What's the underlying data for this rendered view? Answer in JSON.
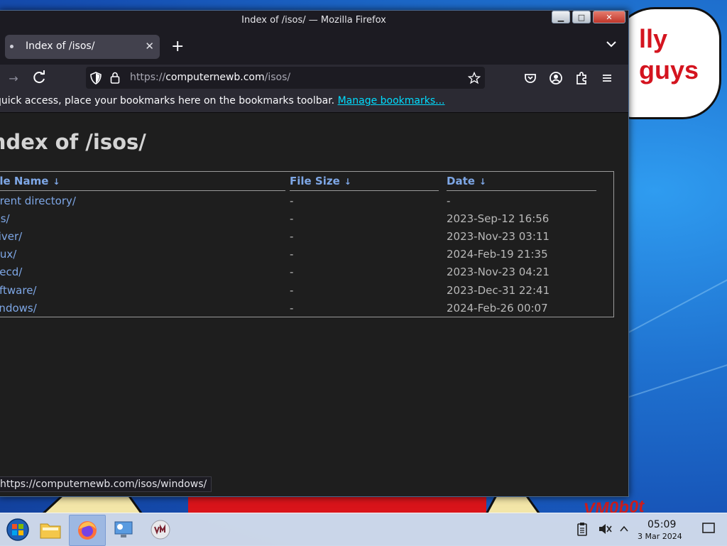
{
  "window": {
    "title": "Index of /isos/ — Mozilla Firefox"
  },
  "tabs": [
    {
      "label": "Index of /isos/"
    }
  ],
  "urlbar": {
    "scheme": "https://",
    "host": "computernewb.com",
    "path": "/isos/"
  },
  "bookmarks_toolbar": {
    "message": "quick access, place your bookmarks here on the bookmarks toolbar.",
    "link_label": "Manage bookmarks..."
  },
  "page": {
    "title": "Index of /isos/",
    "columns": [
      "File Name",
      "File Size",
      "Date"
    ],
    "sort_arrow": "↓",
    "rows": [
      {
        "name": "Parent directory/",
        "size": "-",
        "date": "-"
      },
      {
        "name": "dos/",
        "size": "-",
        "date": "2023-Sep-12 16:56"
      },
      {
        "name": "driver/",
        "size": "-",
        "date": "2023-Nov-23 03:11"
      },
      {
        "name": "linux/",
        "size": "-",
        "date": "2024-Feb-19 21:35"
      },
      {
        "name": "livecd/",
        "size": "-",
        "date": "2023-Nov-23 04:21"
      },
      {
        "name": "software/",
        "size": "-",
        "date": "2023-Dec-31 22:41"
      },
      {
        "name": "windows/",
        "size": "-",
        "date": "2024-Feb-26 00:07"
      }
    ]
  },
  "status_bar": {
    "text": "https://computernewb.com/isos/windows/"
  },
  "wallpaper": {
    "bubble_line1": "lly",
    "bubble_line2": "guys",
    "word": "VM0b0t"
  },
  "taskbar": {
    "clock_time": "05:09",
    "clock_date": "3 Mar 2024",
    "items": [
      "start-button",
      "file-manager",
      "firefox",
      "system-settings",
      "vm-app"
    ]
  },
  "colors": {
    "link": "#7ea7e6",
    "page_bg": "#1e1e1e",
    "chrome_bg": "#2b2a33",
    "accent_link": "#00ddff"
  }
}
